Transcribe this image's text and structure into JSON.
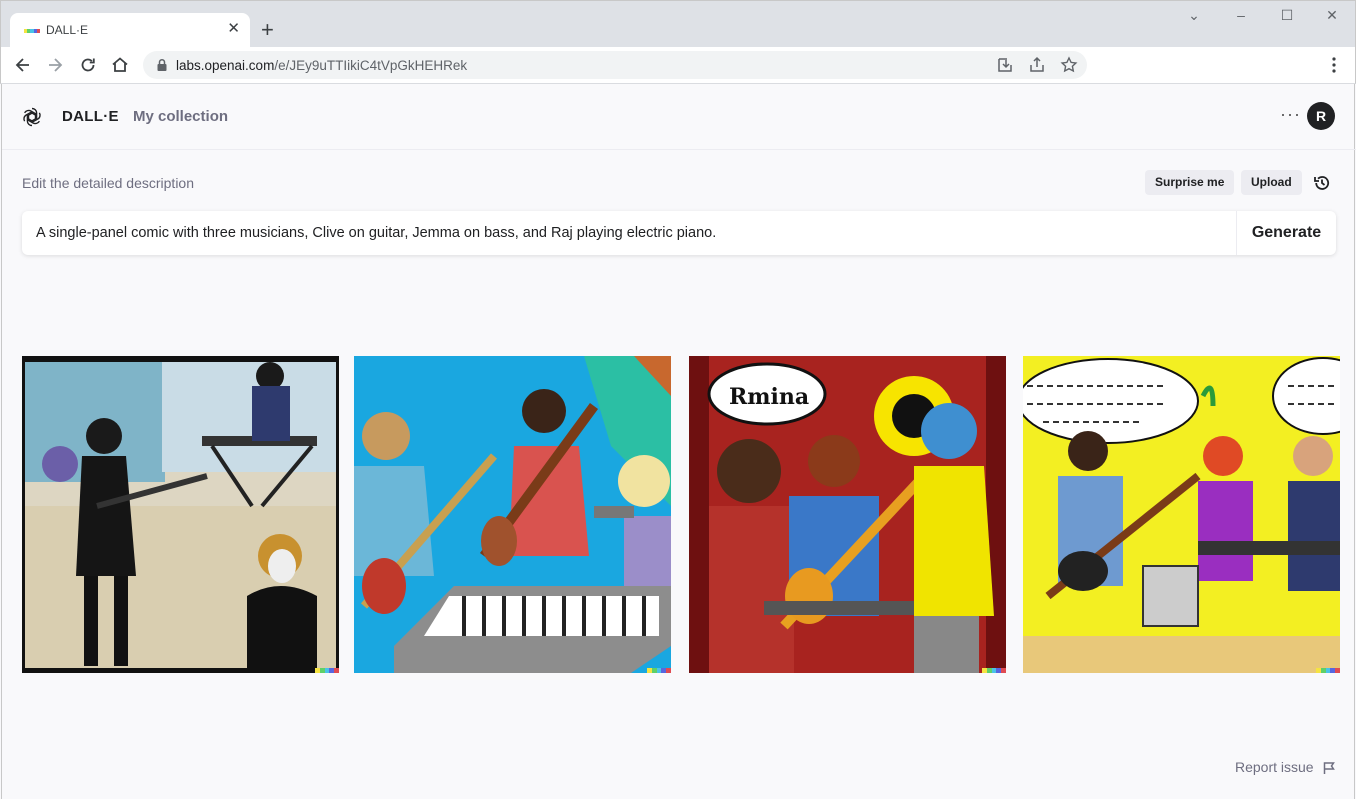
{
  "browser": {
    "tab_title": "DALL·E",
    "new_tab_label": "+",
    "url_host": "labs.openai.com",
    "url_path": "/e/JEy9uTTIikiC4tVpGkHEHRek",
    "window_controls": [
      "⌄",
      "–",
      "☐",
      "✕"
    ]
  },
  "header": {
    "brand": "DALL·E",
    "nav_collection": "My collection",
    "more_label": "···",
    "avatar_initial": "R"
  },
  "editor": {
    "label": "Edit the detailed description",
    "surprise_label": "Surprise me",
    "upload_label": "Upload",
    "prompt": "A single-panel comic with three musicians, Clive on guitar, Jemma on bass, and Raj playing electric piano.",
    "generate_label": "Generate"
  },
  "results": {
    "count": 4,
    "images": [
      {
        "index": 1,
        "description": "comic-black-white-guitarist"
      },
      {
        "index": 2,
        "description": "comic-blue-keyboard-band"
      },
      {
        "index": 3,
        "description": "comic-red-band-speech-bubble"
      },
      {
        "index": 4,
        "description": "comic-yellow-band-speech-bubbles"
      }
    ],
    "bubble_text_3": "Rmina"
  },
  "footer": {
    "report_label": "Report issue"
  },
  "colors": {
    "signature": [
      "#f5e342",
      "#5fd068",
      "#4ac3e8",
      "#5767e0",
      "#e04b52"
    ],
    "avatar_bg": "#202123"
  }
}
